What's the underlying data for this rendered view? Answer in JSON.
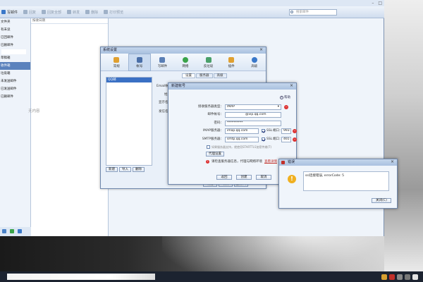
{
  "toolbar": {
    "items": [
      {
        "label": "写邮件"
      },
      {
        "label": "回复"
      },
      {
        "label": "回复全部"
      },
      {
        "label": "转发"
      },
      {
        "label": "删除"
      },
      {
        "label": "打印预览"
      }
    ],
    "search_placeholder": "搜索邮件"
  },
  "sidebar": {
    "items": [
      {
        "label": "文件夹"
      },
      {
        "label": "有未读"
      },
      {
        "label": "已回邮件"
      },
      {
        "label": "已删邮件"
      },
      {
        "label": ""
      },
      {
        "label": "草稿箱"
      },
      {
        "label": "收件箱"
      },
      {
        "label": "垃圾箱"
      },
      {
        "label": "未发送邮件"
      },
      {
        "label": "已发送邮件"
      },
      {
        "label": "已删邮件"
      }
    ]
  },
  "list": {
    "sort_label": "按收日期",
    "empty_text": "无内容"
  },
  "settings_dialog": {
    "title": "系统设置",
    "close": "×",
    "tabs": [
      "常规",
      "帐号",
      "写邮件",
      "网络",
      "反垃圾",
      "插件",
      "高级"
    ],
    "account_entry": "QQ邮",
    "buttons": [
      "新建",
      "导入",
      "删除"
    ],
    "subtabs": [
      "设置",
      "服务器",
      "高级"
    ],
    "right_labels": [
      "Email帐",
      "姓",
      "显示名",
      "发信名"
    ],
    "bottom_buttons": [
      "确定",
      "取消",
      "应用(A)"
    ]
  },
  "new_account_dialog": {
    "title": "新建帐号",
    "close": "×",
    "help": "帮助",
    "fields": {
      "server_type_label": "接收服务器类型：",
      "server_type_value": "IMAP",
      "email_label": "邮件帐号：",
      "email_value": "@vip.qq.com",
      "password_label": "密码：",
      "password_value": "**********",
      "imap_label": "IMAP服务器：",
      "imap_value": "imap.qq.com",
      "smtp_label": "SMTP服务器：",
      "smtp_value": "smtp.qq.com",
      "ssl_label": "SSL",
      "port_label": "端口：",
      "imap_port": "993",
      "smtp_port": "465"
    },
    "auth_note": "如果服务器支持，就使用STARTTLS加密传输(T)",
    "proxy_button": "代理设置",
    "warning": "请检查服务器信息，代理与网络环境",
    "warning_link": "查看详情",
    "buttons": [
      "返回",
      "创建",
      "取消"
    ]
  },
  "error_dialog": {
    "title": "错误",
    "close": "×",
    "icon": "!",
    "message": "ssl连接错误, errorCode: 5",
    "button": "关闭(C)"
  },
  "taskbar": {
    "time": "",
    "date": ""
  }
}
